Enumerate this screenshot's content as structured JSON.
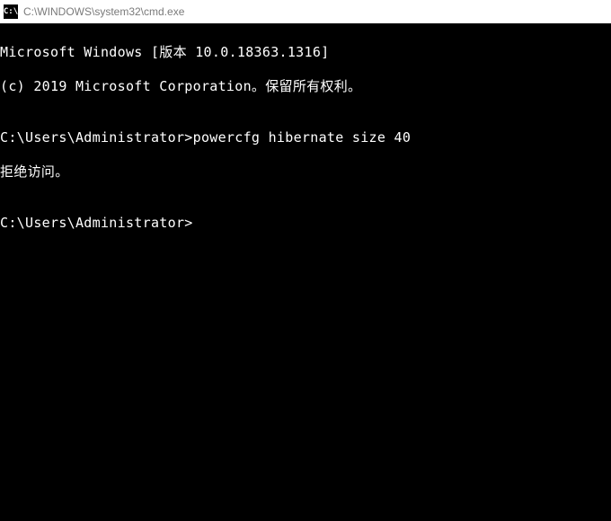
{
  "titlebar": {
    "icon_text": "C:\\",
    "title": "C:\\WINDOWS\\system32\\cmd.exe"
  },
  "terminal": {
    "line1": "Microsoft Windows [版本 10.0.18363.1316]",
    "line2": "(c) 2019 Microsoft Corporation。保留所有权利。",
    "blank1": "",
    "prompt1": "C:\\Users\\Administrator>",
    "command1": "powercfg hibernate size 40",
    "response1": "拒绝访问。",
    "blank2": "",
    "prompt2": "C:\\Users\\Administrator>"
  }
}
